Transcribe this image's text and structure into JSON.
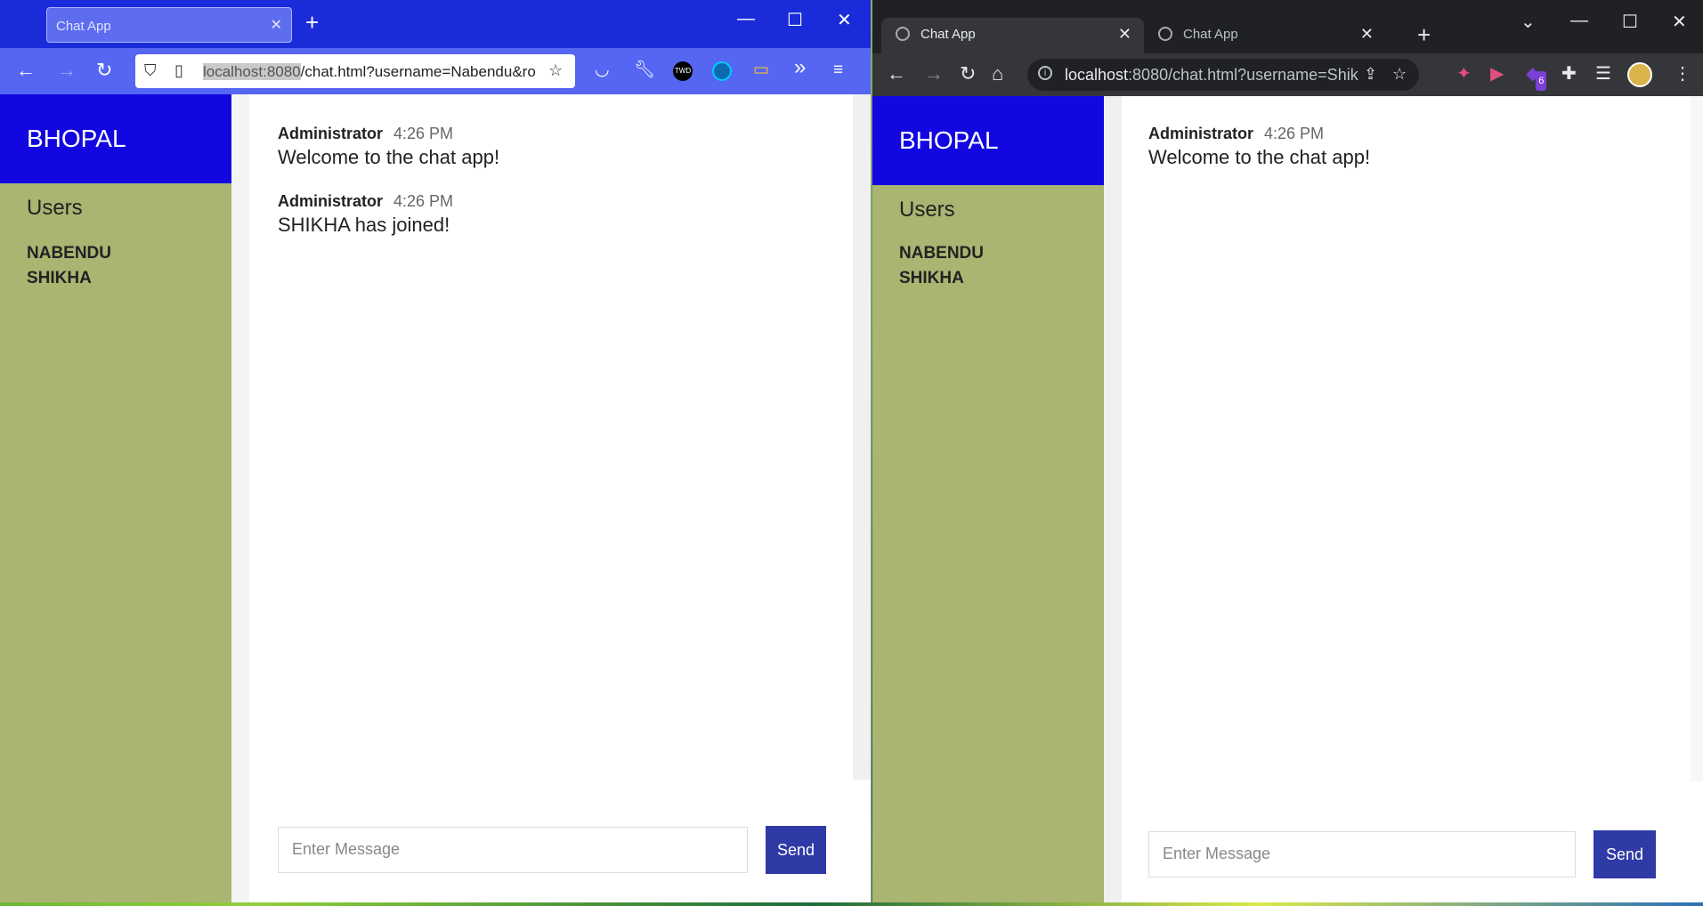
{
  "left_window": {
    "tab_title": "Chat App",
    "url_host": "localhost:8080",
    "url_rest": "/chat.html?username=Nabendu&ro",
    "icons": [
      "back-icon",
      "forward-icon",
      "reload-icon",
      "shield-icon",
      "page-icon",
      "star-icon",
      "pocket-icon",
      "wrench-icon",
      "twd-icon",
      "globe-extension-icon",
      "screen-icon",
      "overflow-icon",
      "menu-icon"
    ],
    "twd_label": "TWD"
  },
  "right_window": {
    "tabs": [
      {
        "title": "Chat App"
      },
      {
        "title": "Chat App"
      }
    ],
    "url_host": "localhost",
    "url_rest": ":8080/chat.html?username=Shik...",
    "extension_badge": "6"
  },
  "app_left": {
    "room": "BHOPAL",
    "users_heading": "Users",
    "users": [
      "NABENDU",
      "SHIKHA"
    ],
    "messages": [
      {
        "name": "Administrator",
        "time": "4:26 PM",
        "text": "Welcome to the chat app!"
      },
      {
        "name": "Administrator",
        "time": "4:26 PM",
        "text": "SHIKHA has joined!"
      }
    ],
    "input_placeholder": "Enter Message",
    "send_label": "Send"
  },
  "app_right": {
    "room": "BHOPAL",
    "users_heading": "Users",
    "users": [
      "NABENDU",
      "SHIKHA"
    ],
    "messages": [
      {
        "name": "Administrator",
        "time": "4:26 PM",
        "text": "Welcome to the chat app!"
      }
    ],
    "input_placeholder": "Enter Message",
    "send_label": "Send"
  },
  "colors": {
    "sidebar": "#a9b571",
    "room_header": "#1207e0",
    "send_button": "#2f3aa6",
    "firefox_bar": "#1a2bd9",
    "chrome_bar": "#202124"
  }
}
